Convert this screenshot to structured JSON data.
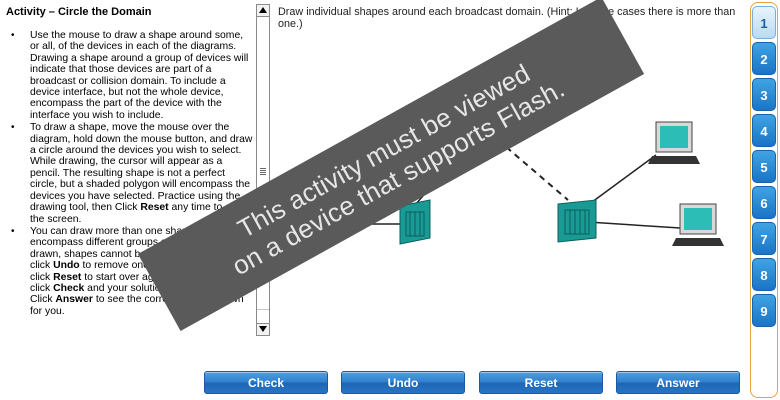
{
  "activity": {
    "title": "Activity – Circle the Domain",
    "instructions": [
      {
        "segments": [
          {
            "text": "Use the mouse to draw a shape around some, or all, of the devices in each of the diagrams. Drawing a shape around a group of devices will indicate that those devices are part of a broadcast or collision domain. To include a device interface, but not the whole device, encompass the part of the device with the interface you wish to include.",
            "bold": false
          }
        ]
      },
      {
        "segments": [
          {
            "text": "To draw a shape, move the mouse over the diagram, hold down the mouse button, and draw a circle around the devices you wish to select. While drawing, the cursor will appear as a pencil. The resulting shape is not a perfect circle, but a shaded polygon will encompass the devices you have selected. Practice using the drawing tool, then Click ",
            "bold": false
          },
          {
            "text": "Reset",
            "bold": true
          },
          {
            "text": " any time to clear the screen.",
            "bold": false
          }
        ]
      },
      {
        "segments": [
          {
            "text": "You can draw more than one shape to encompass different groups of devices. When drawn, shapes cannot be changed, but you can click ",
            "bold": false
          },
          {
            "text": "Undo",
            "bold": true
          },
          {
            "text": " to remove one shape at a time, or click ",
            "bold": false
          },
          {
            "text": "Reset",
            "bold": true
          },
          {
            "text": " to start over again. When ready, click ",
            "bold": false
          },
          {
            "text": "Check",
            "bold": true
          },
          {
            "text": " and your solution will be evaluated. Click ",
            "bold": false
          },
          {
            "text": "Answer",
            "bold": true
          },
          {
            "text": " to see the correct answer drawn for you.",
            "bold": false
          }
        ]
      }
    ]
  },
  "diagram": {
    "instruction": "Draw individual shapes around each broadcast domain. (Hint: In some cases there is more than one.)"
  },
  "overlay": {
    "line1": "This activity must be viewed",
    "line2": "on a device that supports Flash."
  },
  "buttons": {
    "check": "Check",
    "undo": "Undo",
    "reset": "Reset",
    "answer": "Answer"
  },
  "tabs": [
    "1",
    "2",
    "3",
    "4",
    "5",
    "6",
    "7",
    "8",
    "9"
  ],
  "active_tab": "1",
  "colors": {
    "device_teal": "#1a9a95",
    "button_blue": "#2f7fcf",
    "tab_frame": "#e8a23c",
    "banner_gray": "#5a5a5a"
  }
}
